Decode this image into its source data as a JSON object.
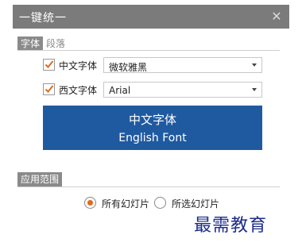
{
  "window": {
    "title": "一键统一"
  },
  "tabs": [
    {
      "label": "字体",
      "active": true
    },
    {
      "label": "段落",
      "active": false
    }
  ],
  "font_settings": {
    "chinese": {
      "label": "中文字体",
      "checked": true,
      "font": "微软雅黑"
    },
    "western": {
      "label": "西文字体",
      "checked": true,
      "font": "Arial"
    }
  },
  "preview": {
    "chinese": "中文字体",
    "english": "English Font"
  },
  "scope": {
    "section_title": "应用范围",
    "options": [
      {
        "label": "所有幻灯片",
        "selected": true
      },
      {
        "label": "所选幻灯片",
        "selected": false
      }
    ]
  },
  "watermark": "最需教育",
  "colors": {
    "titlebar": "#7b7b7b",
    "preview_bg": "#1f5aa0",
    "accent": "#e06a1c"
  }
}
